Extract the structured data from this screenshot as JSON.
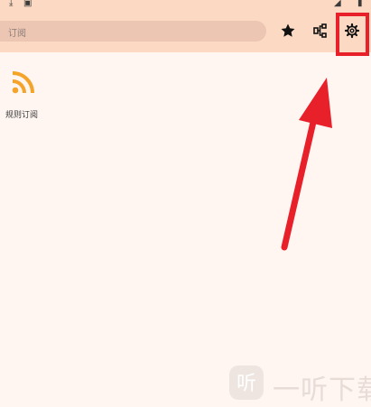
{
  "search": {
    "placeholder": "订阅"
  },
  "toolbar": {
    "star": "favorites",
    "link": "rules",
    "settings": "settings"
  },
  "subscriptions": [
    {
      "label": "规则订阅",
      "icon": "rss-icon"
    }
  ],
  "watermark": {
    "text": "一听下载"
  },
  "colors": {
    "appbar": "#fbd9c2",
    "background": "#fff6f2",
    "highlight": "#e8202a",
    "rss": "#f4a42a"
  }
}
